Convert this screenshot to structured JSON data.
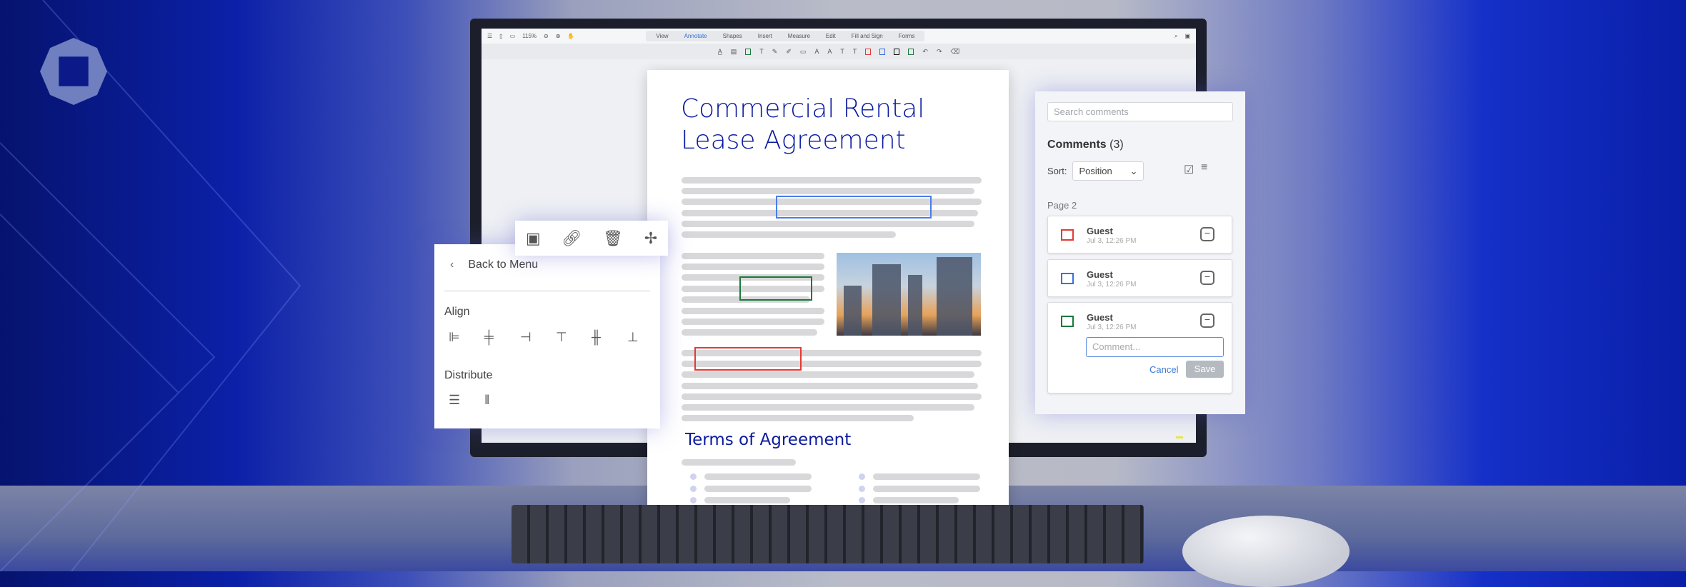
{
  "toolbar": {
    "zoom": "115%",
    "tabs": [
      "View",
      "Annotate",
      "Shapes",
      "Insert",
      "Measure",
      "Edit",
      "Fill and Sign",
      "Forms"
    ],
    "active_tab": "Annotate"
  },
  "document": {
    "title_line1": "Commercial Rental",
    "title_line2": "Lease Agreement",
    "section_heading": "Terms of Agreement"
  },
  "comments": {
    "search_placeholder": "Search comments",
    "heading": "Comments",
    "count": "(3)",
    "sort_label": "Sort:",
    "sort_value": "Position",
    "page_label": "Page 2",
    "items": [
      {
        "author": "Guest",
        "date": "Jul 3, 12:26 PM",
        "color": "#e53935"
      },
      {
        "author": "Guest",
        "date": "Jul 3, 12:26 PM",
        "color": "#3b6fe0"
      },
      {
        "author": "Guest",
        "date": "Jul 3, 12:26 PM",
        "color": "#1b7a3a"
      }
    ],
    "input_placeholder": "Comment...",
    "cancel": "Cancel",
    "save": "Save"
  },
  "align_panel": {
    "back": "Back to Menu",
    "align": "Align",
    "distribute": "Distribute"
  }
}
